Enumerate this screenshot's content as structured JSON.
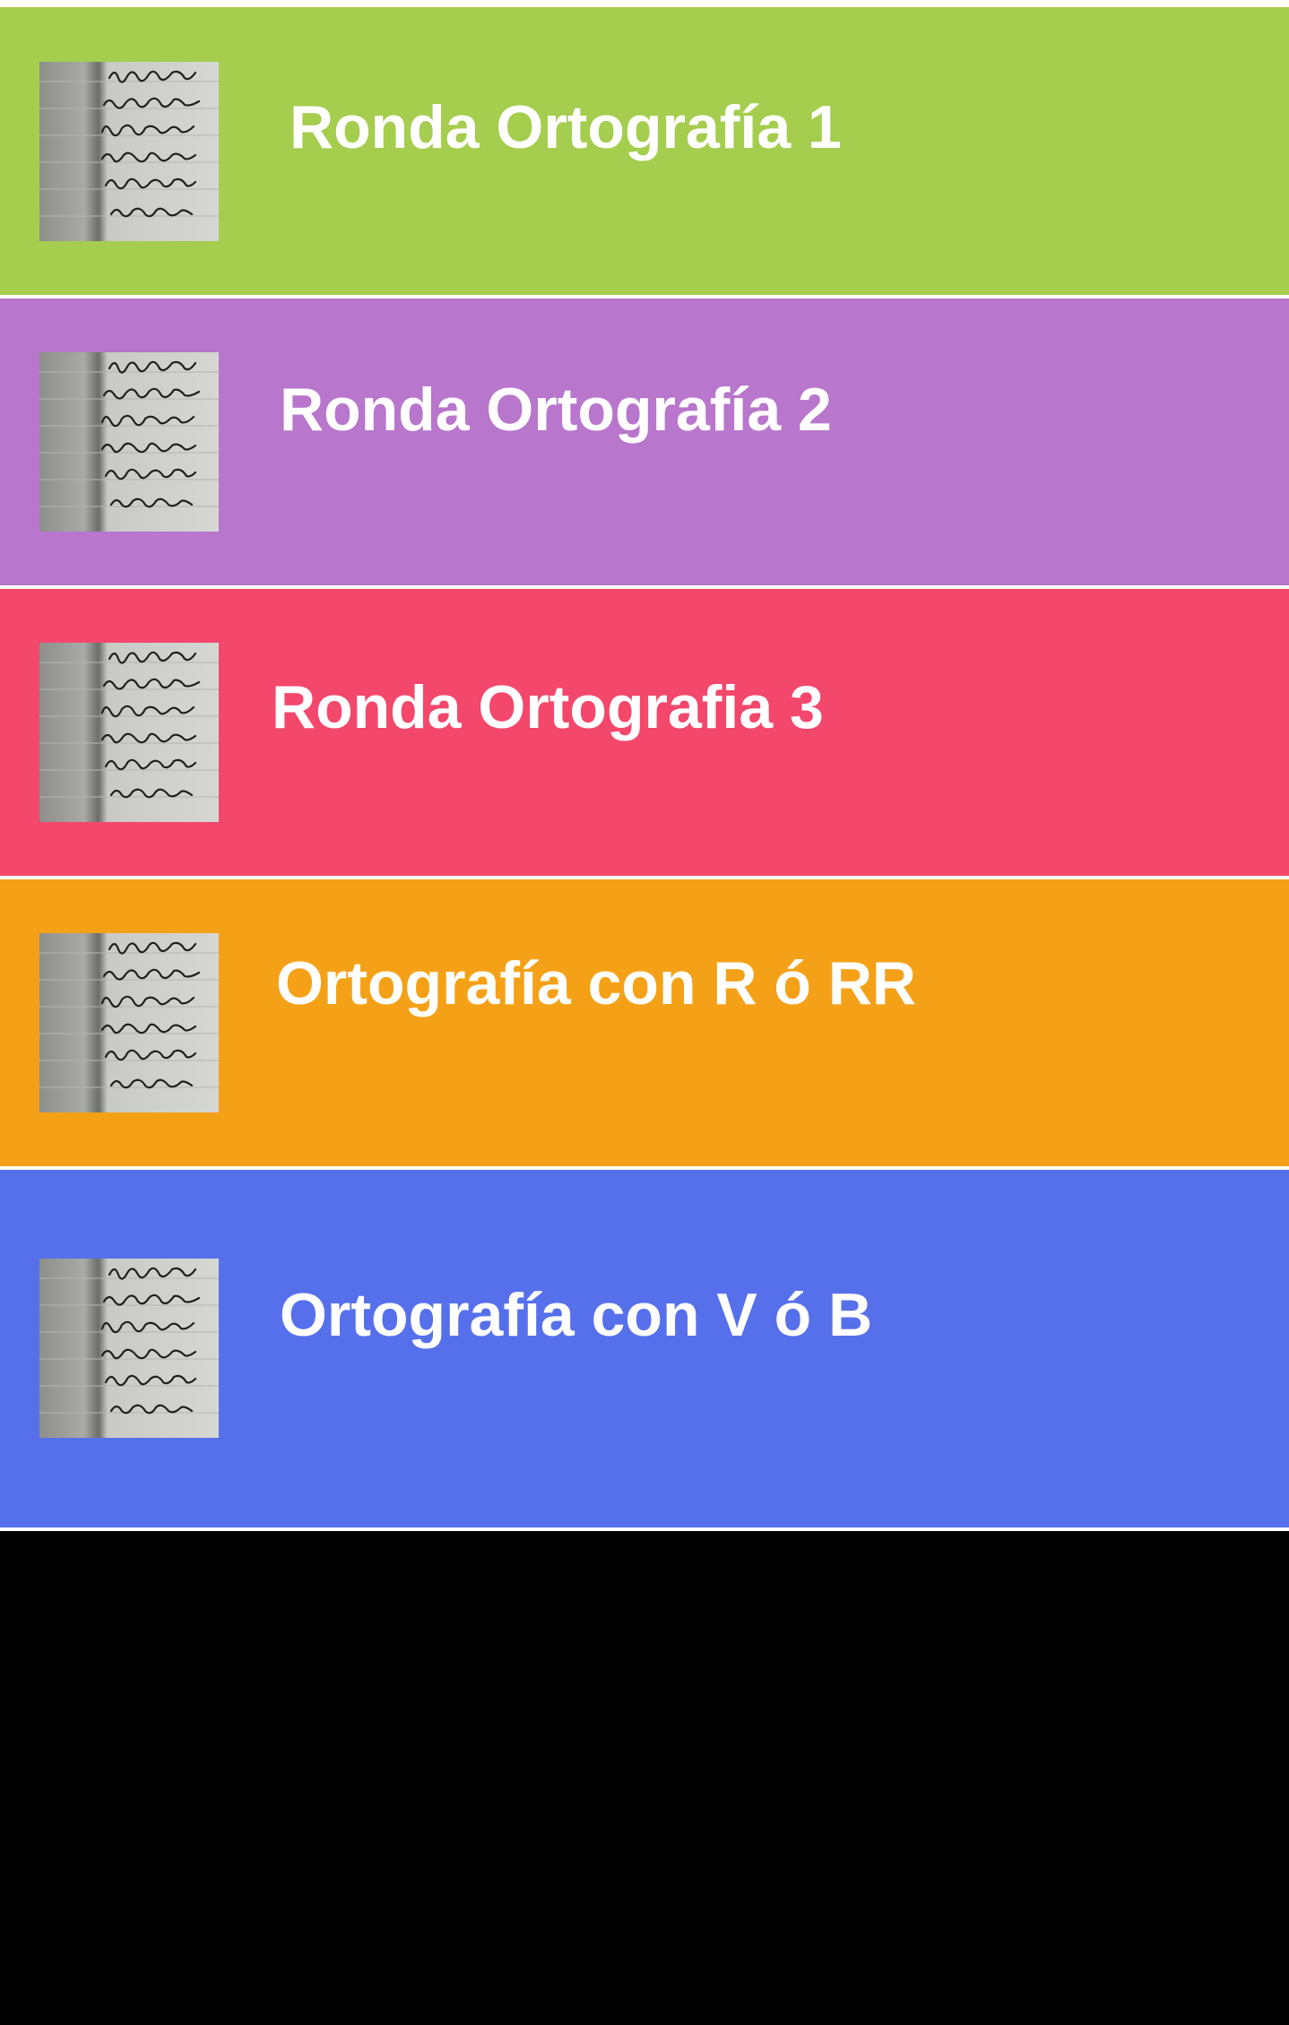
{
  "list": {
    "items": [
      {
        "label": "Ronda Ortografía 1",
        "color": "#a5cd4e",
        "thumbnail": "handwriting-notebook-thumbnail"
      },
      {
        "label": "Ronda Ortografía 2",
        "color": "#b876cc",
        "thumbnail": "handwriting-notebook-thumbnail"
      },
      {
        "label": "Ronda Ortografia 3",
        "color": "#f3476c",
        "thumbnail": "handwriting-notebook-thumbnail"
      },
      {
        "label": "Ortografía con R ó RR",
        "color": "#f5a117",
        "thumbnail": "handwriting-notebook-thumbnail"
      },
      {
        "label": "Ortografía con V ó B",
        "color": "#5670ec",
        "thumbnail": "handwriting-notebook-thumbnail"
      }
    ]
  },
  "colors": {
    "divider": "#ffffff",
    "background": "#000000",
    "text": "#ffffff"
  }
}
